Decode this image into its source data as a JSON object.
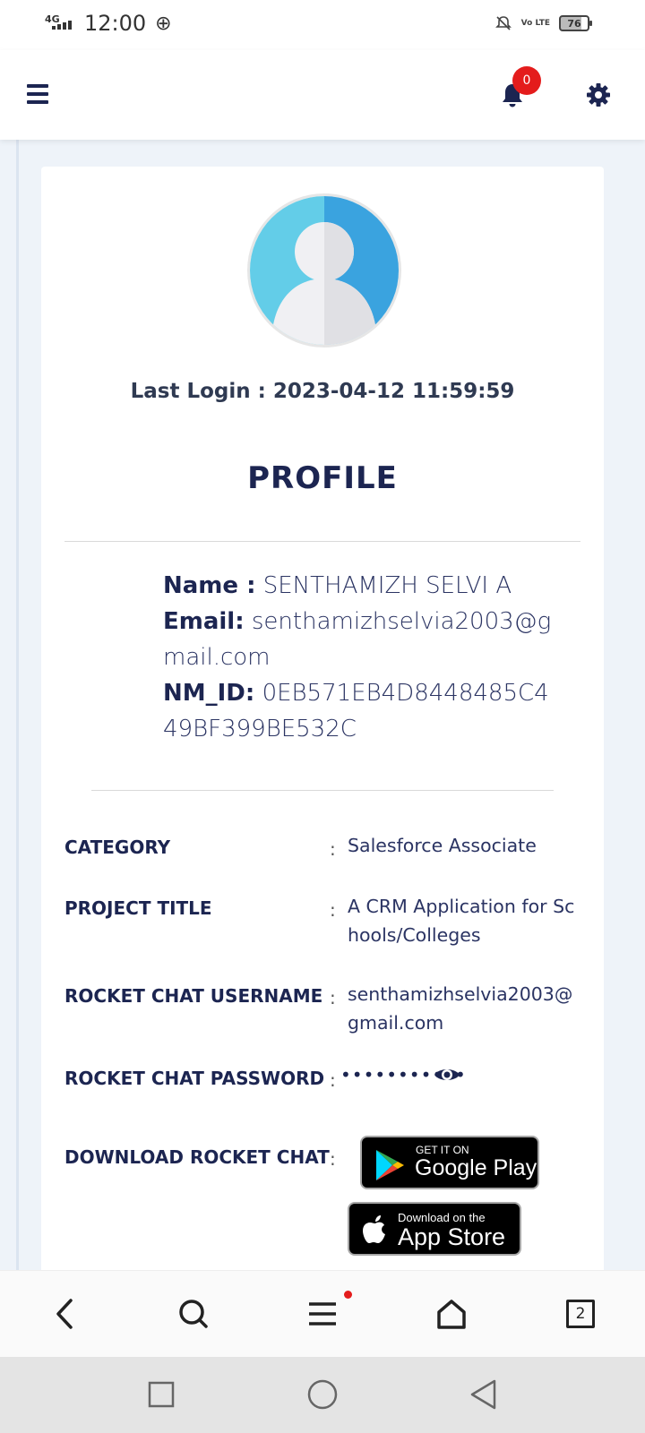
{
  "status_bar": {
    "network": "4G",
    "time": "12:00",
    "volte": "Vo LTE",
    "battery": "76"
  },
  "header": {
    "notification_count": "0"
  },
  "profile": {
    "last_login": "Last Login : 2023-04-12 11:59:59",
    "title": "PROFILE",
    "name_label": "Name :",
    "name_value": "SENTHAMIZH SELVI A",
    "email_label": "Email:",
    "email_value": "senthamizhselvia2003@gmail.com",
    "nmid_label": "NM_ID:",
    "nmid_value": "0EB571EB4D8448485C449BF399BE532C"
  },
  "details": [
    {
      "label": "CATEGORY",
      "colon": ":",
      "value": "Salesforce Associate"
    },
    {
      "label": "PROJECT TITLE",
      "colon": ":",
      "value": "A CRM Application for Schools/Colleges"
    },
    {
      "label": "ROCKET CHAT USERNAME",
      "colon": ":",
      "value": "senthamizhselvia2003@gmail.com"
    },
    {
      "label": "ROCKET CHAT PASSWORD",
      "colon": ":",
      "value": "•••••••••••"
    },
    {
      "label": "DOWNLOAD ROCKET CHAT",
      "colon": ":",
      "value": ""
    }
  ],
  "stores": {
    "google_small": "GET IT ON",
    "google_big": "Google Play",
    "apple_small": "Download on the",
    "apple_big": "App Store"
  },
  "browser_bar": {
    "tab_count": "2"
  },
  "colors": {
    "navy": "#1c2551",
    "badge_red": "#e41c1c",
    "background": "#eef3f9"
  },
  "icons": [
    "menu-icon",
    "bell-icon",
    "gear-icon",
    "eye-icon",
    "back-icon",
    "search-icon",
    "tabs-menu-icon",
    "home-icon",
    "recent-apps-icon",
    "home-circle-icon",
    "back-triangle-icon"
  ]
}
